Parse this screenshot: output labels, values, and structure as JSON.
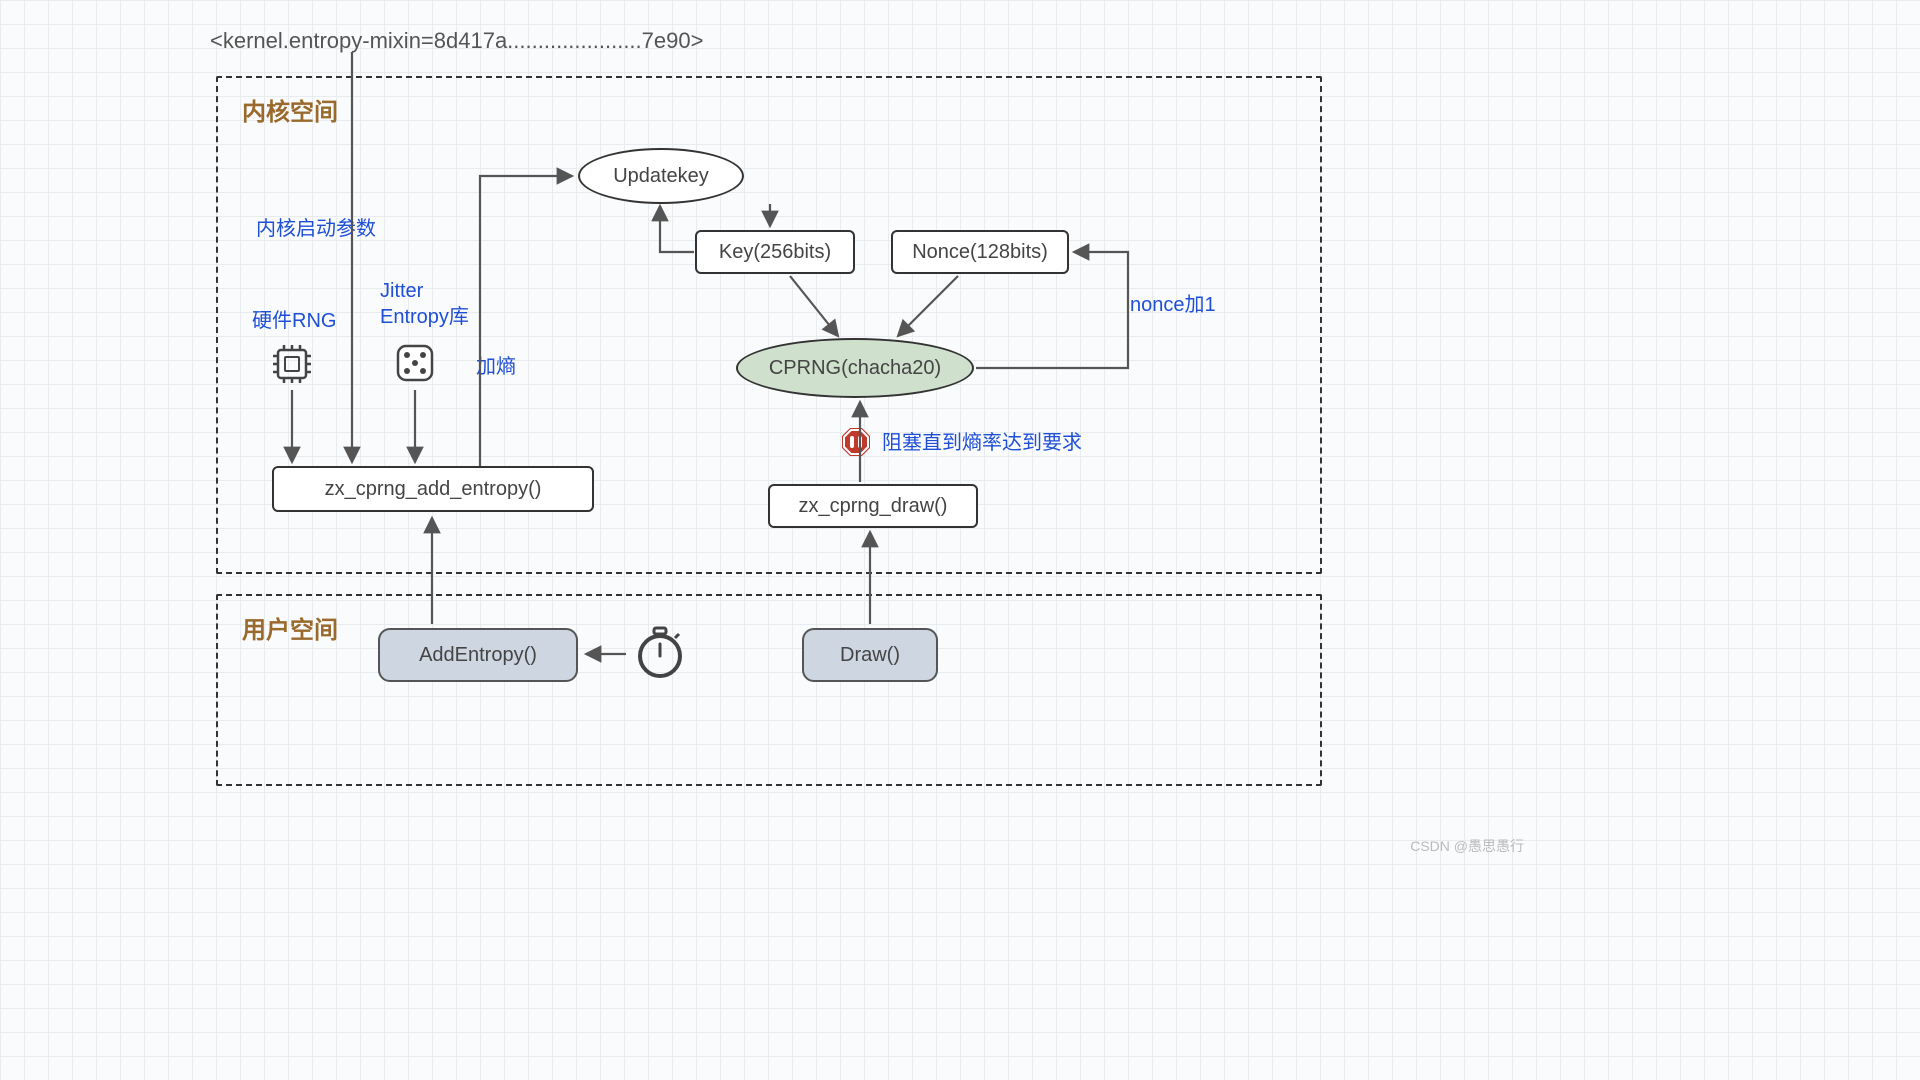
{
  "header": "<kernel.entropy-mixin=8d417a......................7e90>",
  "spaces": {
    "kernel_title": "内核空间",
    "user_title": "用户空间"
  },
  "nodes": {
    "updatekey": "Updatekey",
    "key": "Key(256bits)",
    "nonce": "Nonce(128bits)",
    "cprng": "CPRNG(chacha20)",
    "add_entropy_sys": "zx_cprng_add_entropy()",
    "draw_sys": "zx_cprng_draw()",
    "add_entropy_user": "AddEntropy()",
    "draw_user": "Draw()"
  },
  "labels": {
    "kernel_boot_param": "内核启动参数",
    "hw_rng": "硬件RNG",
    "jitter_line1": "Jitter",
    "jitter_line2": "Entropy库",
    "add_entropy_cn": "加熵",
    "nonce_plus": "nonce加1",
    "block_until": "阻塞直到熵率达到要求"
  },
  "watermark": "CSDN @愚思愚行"
}
